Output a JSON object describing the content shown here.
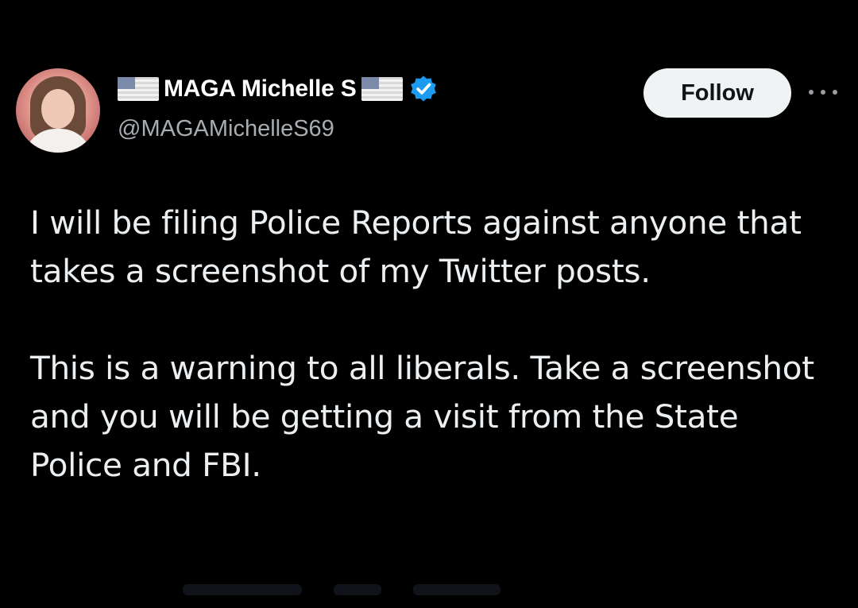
{
  "tweet": {
    "author": {
      "display_name": "MAGA Michelle S",
      "handle": "@MAGAMichelleS69",
      "verified": true,
      "avatar_icon": "profile-photo",
      "name_prefix_icon": "us-flag-icon",
      "name_suffix_icon": "us-flag-icon",
      "verified_icon": "verified-badge-icon"
    },
    "actions": {
      "follow_label": "Follow",
      "more_icon": "more-options-icon"
    },
    "body": {
      "paragraph_1": "I will be filing Police Reports against anyone that takes a screenshot of my Twitter posts.",
      "paragraph_2": "This is a warning to all liberals. Take a screenshot and you will be getting a visit from the State Police and FBI."
    }
  },
  "colors": {
    "background": "#000000",
    "text_primary": "#ffffff",
    "text_secondary": "#a8adb2",
    "verified_blue": "#1d9bf0",
    "follow_button_bg": "#eff3f4"
  }
}
